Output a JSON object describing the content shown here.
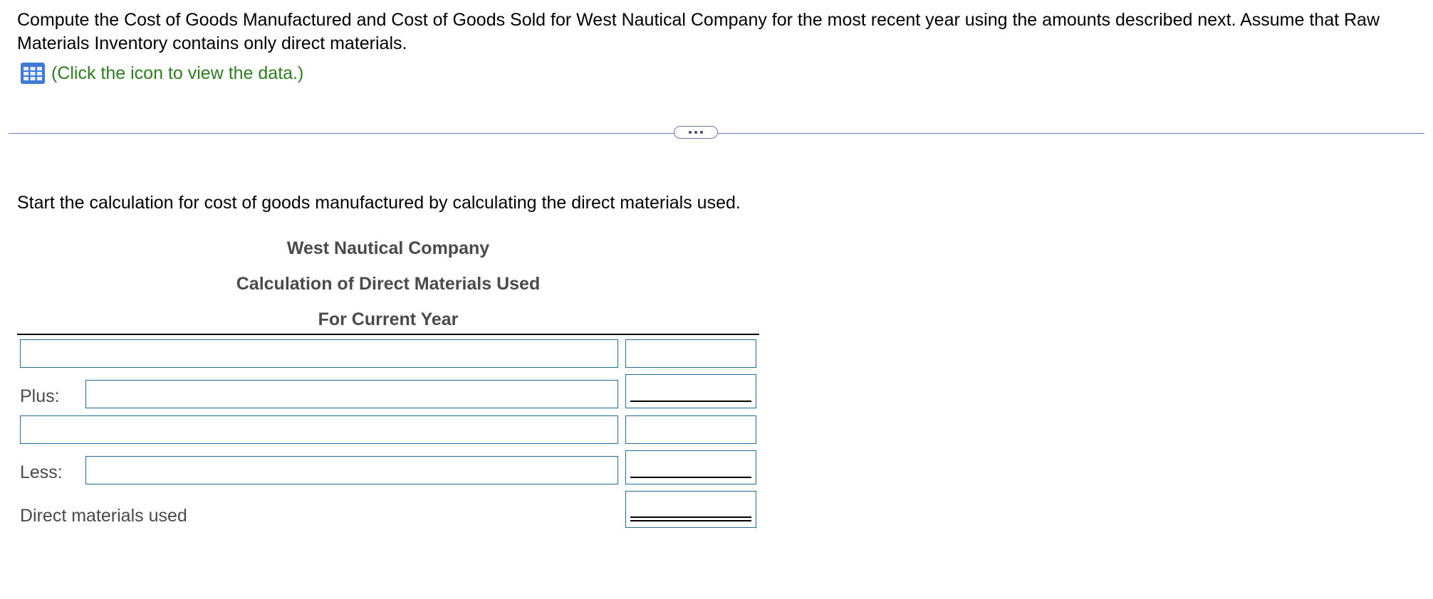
{
  "problem": {
    "intro": "Compute the Cost of Goods Manufactured and Cost of Goods Sold for West Nautical Company for the most recent year using the amounts described next. Assume that Raw Materials Inventory contains only direct materials.",
    "data_link": "(Click the icon to view the data.)",
    "data_icon": "table-grid-icon",
    "link_color": "#2e7d1e"
  },
  "divider": {
    "accent": "#6a7ea6"
  },
  "step": {
    "instruction": "Start the calculation for cost of goods manufactured by calculating the direct materials used."
  },
  "statement": {
    "company": "West Nautical Company",
    "title": "Calculation of Direct Materials Used",
    "period": "For Current Year",
    "rows": [
      {
        "label": "",
        "description": "",
        "amount": ""
      },
      {
        "label": "Plus:",
        "description": "",
        "amount": ""
      },
      {
        "label": "",
        "description": "",
        "amount": ""
      },
      {
        "label": "Less:",
        "description": "",
        "amount": ""
      },
      {
        "label": "Direct materials used",
        "description": "",
        "amount": ""
      }
    ],
    "field_border_color": "#1f6e93"
  }
}
